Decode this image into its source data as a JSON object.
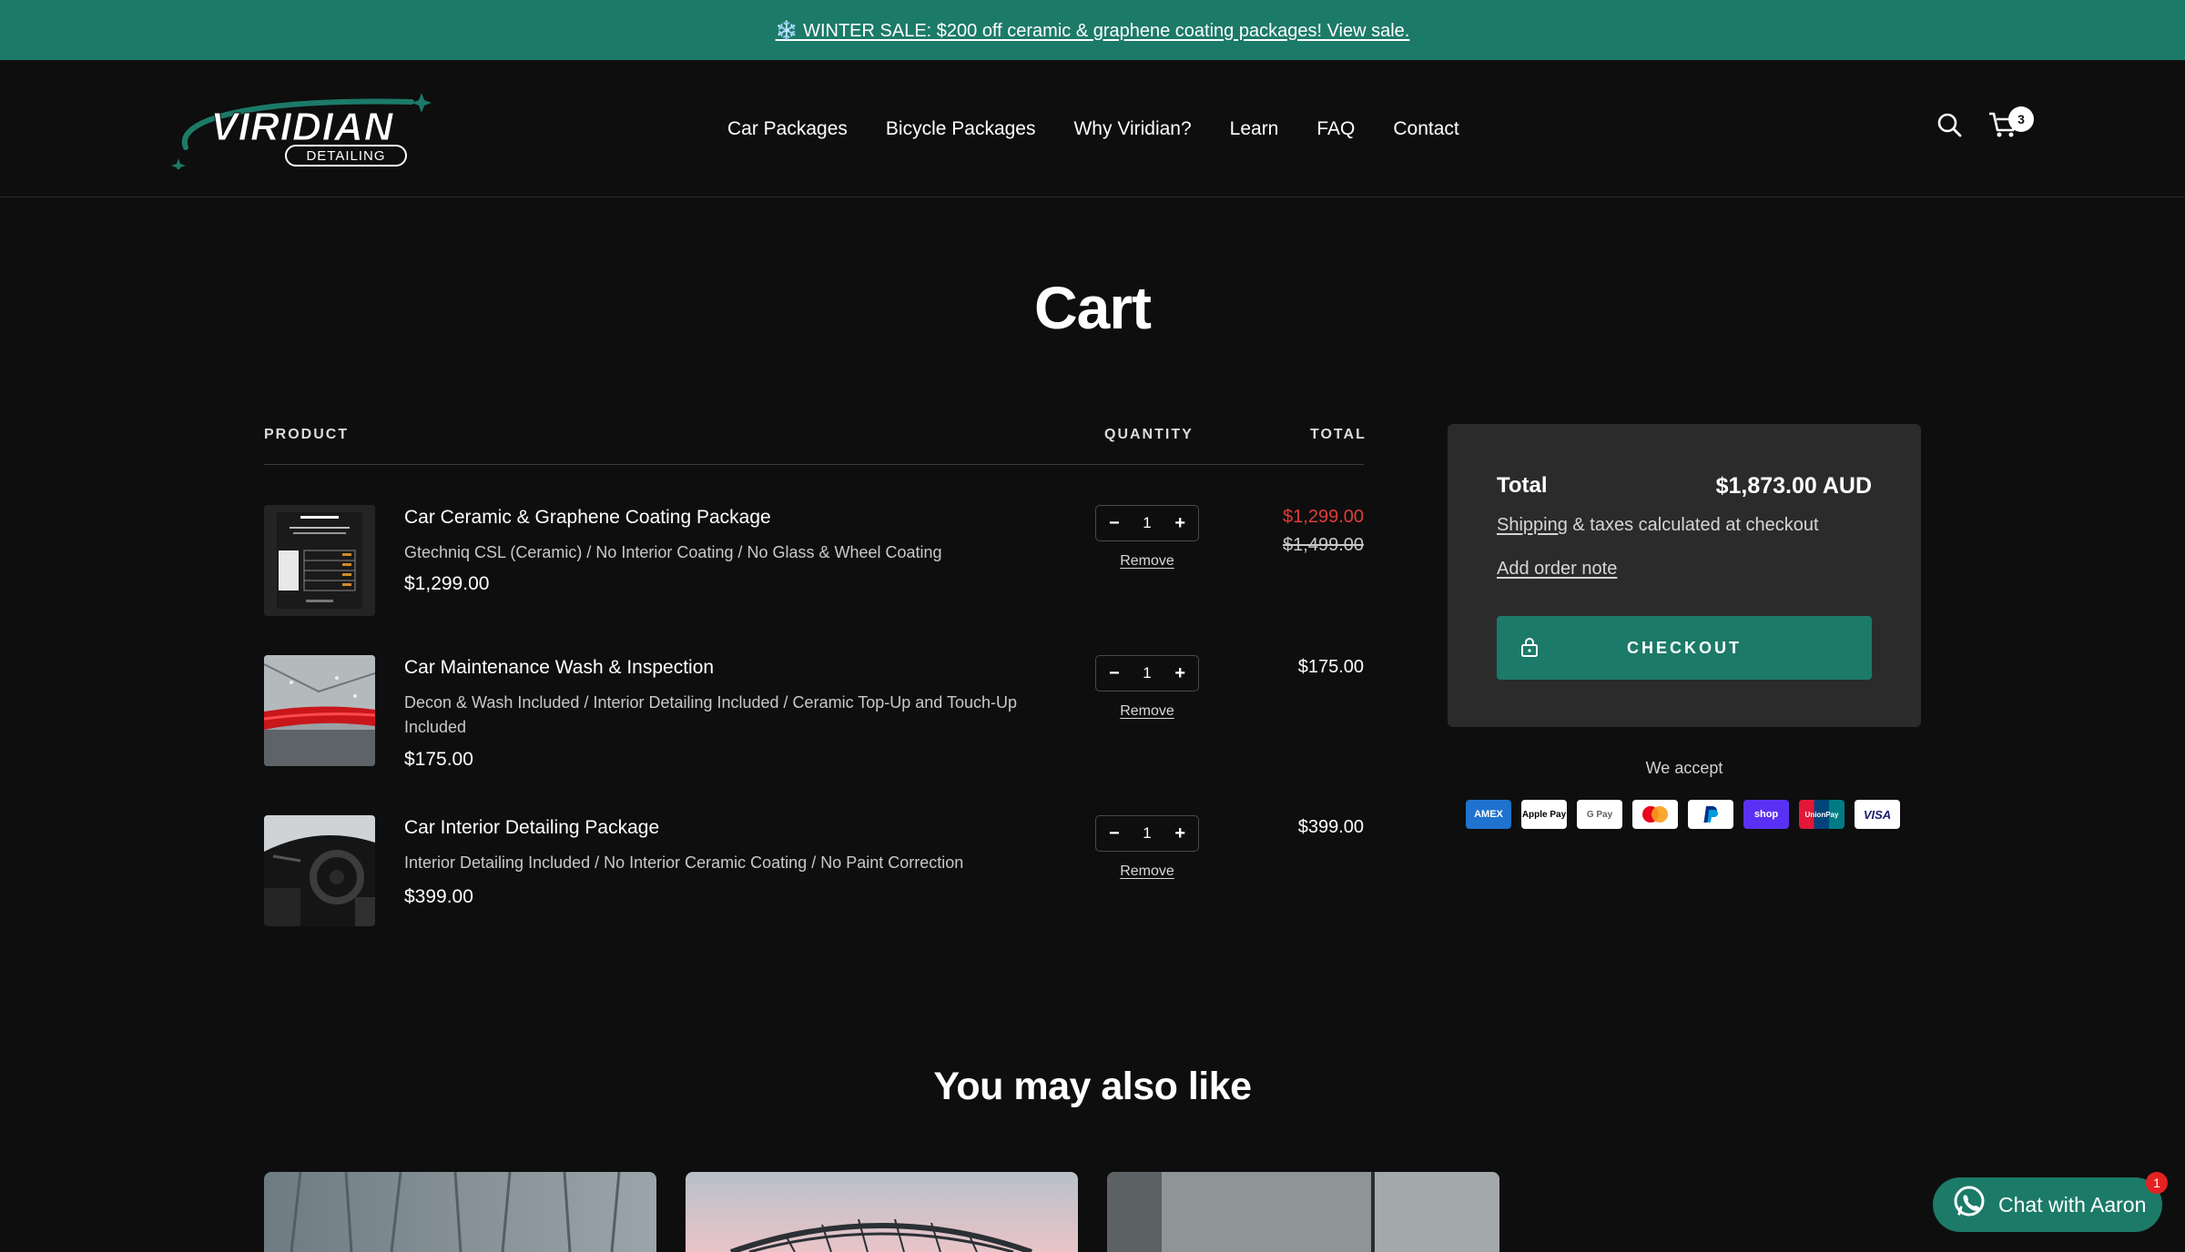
{
  "announcement": {
    "text": "❄️ WINTER SALE: $200 off ceramic & graphene coating packages! View sale."
  },
  "brand": {
    "name": "VIRIDIAN",
    "sub": "DETAILING",
    "accent": "#1c7a68"
  },
  "nav": {
    "items": [
      "Car Packages",
      "Bicycle Packages",
      "Why Viridian?",
      "Learn",
      "FAQ",
      "Contact"
    ]
  },
  "header": {
    "cart_count": "3"
  },
  "page": {
    "title": "Cart"
  },
  "cart": {
    "col_product": "PRODUCT",
    "col_quantity": "QUANTITY",
    "col_total": "TOTAL",
    "items": [
      {
        "name": "Car Ceramic & Graphene Coating Package",
        "variant": "Gtechniq CSL (Ceramic) / No Interior Coating / No Glass & Wheel Coating",
        "price": "$1,299.00",
        "qty": "1",
        "total": "$1,299.00",
        "compare_at": "$1,499.00",
        "remove": "Remove"
      },
      {
        "name": "Car Maintenance Wash & Inspection",
        "variant": "Decon & Wash Included / Interior Detailing Included / Ceramic Top-Up and Touch-Up Included",
        "price": "$175.00",
        "qty": "1",
        "total": "$175.00",
        "remove": "Remove"
      },
      {
        "name": "Car Interior Detailing Package",
        "variant": "Interior Detailing Included / No Interior Ceramic Coating / No Paint Correction",
        "price": "$399.00",
        "qty": "1",
        "total": "$399.00",
        "remove": "Remove"
      }
    ],
    "qty_minus": "−",
    "qty_plus": "+"
  },
  "summary": {
    "total_label": "Total",
    "total_value": "$1,873.00 AUD",
    "shipping_link": "Shipping",
    "shipping_rest": " & taxes calculated at checkout",
    "order_note": "Add order note",
    "checkout": "CHECKOUT"
  },
  "payments": {
    "label": "We accept",
    "methods": [
      "AMEX",
      "Apple Pay",
      "G Pay",
      "Mastercard",
      "PayPal",
      "shop",
      "UnionPay",
      "VISA"
    ]
  },
  "recommendations": {
    "title": "You may also like"
  },
  "chat": {
    "label": "Chat with Aaron",
    "badge": "1"
  }
}
